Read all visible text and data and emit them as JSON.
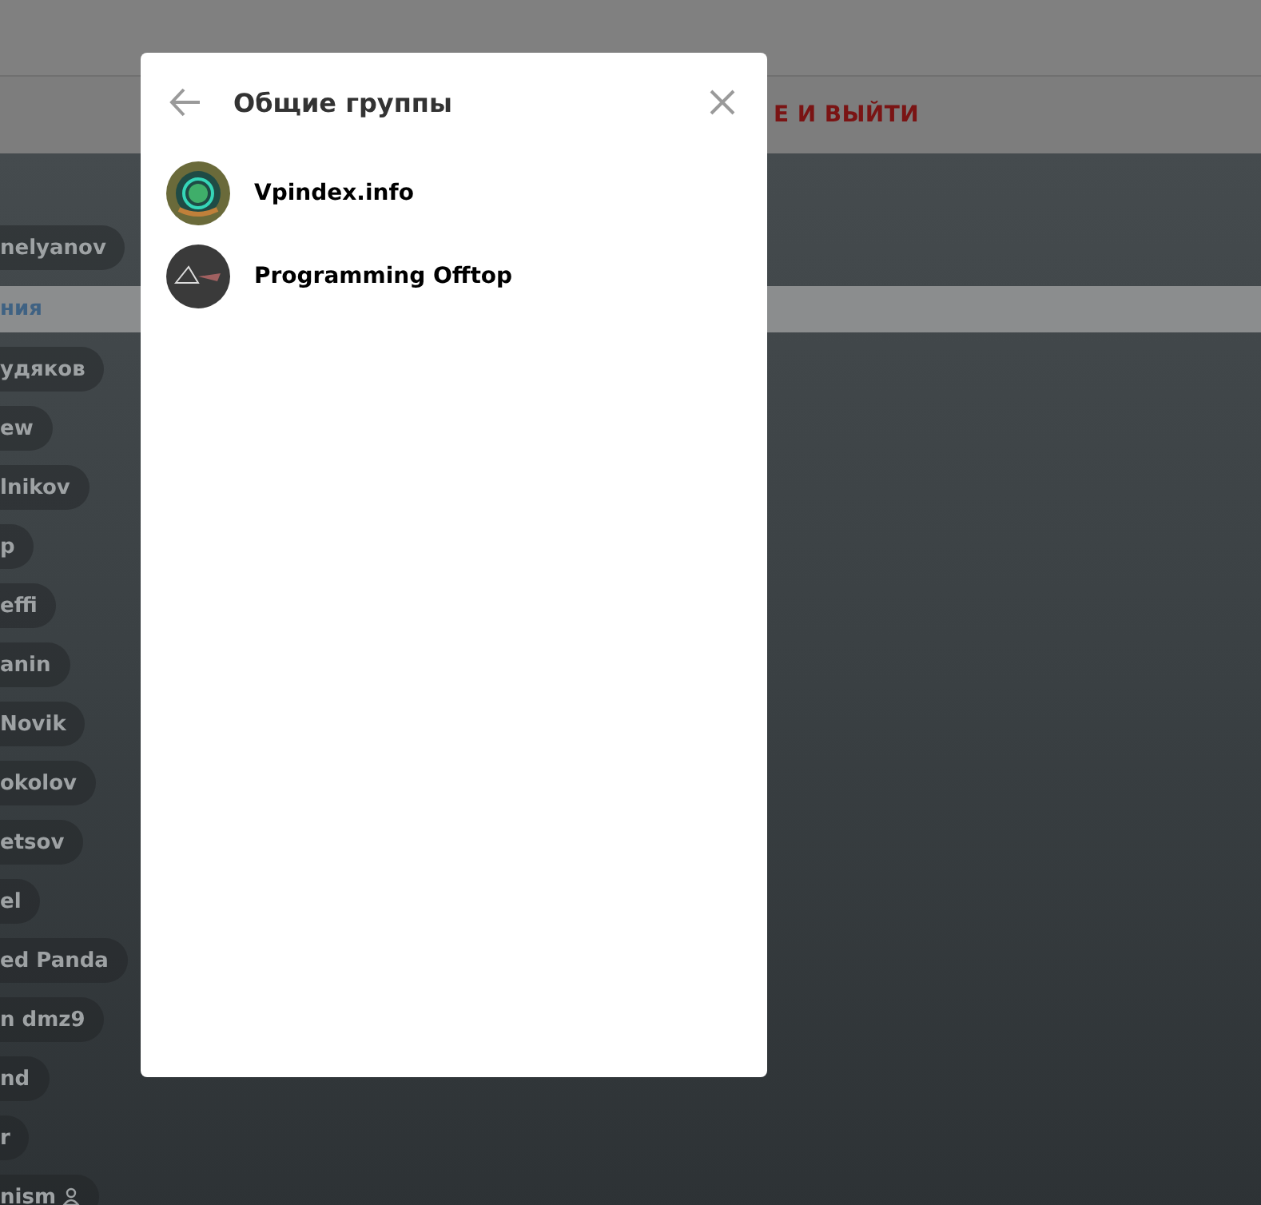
{
  "background": {
    "header_action": "Е И ВЫЙТИ",
    "top_chip": "nelyanov",
    "strip_label": "ния",
    "chips": [
      {
        "label": "удяков",
        "badge": false
      },
      {
        "label": "ew",
        "badge": false
      },
      {
        "label": "lnikov",
        "badge": false
      },
      {
        "label": "p",
        "badge": false
      },
      {
        "label": "effi",
        "badge": false
      },
      {
        "label": "anin",
        "badge": false
      },
      {
        "label": "Novik",
        "badge": false
      },
      {
        "label": "okolov",
        "badge": false
      },
      {
        "label": "etsov",
        "badge": false
      },
      {
        "label": "el",
        "badge": false
      },
      {
        "label": "ed Panda",
        "badge": false
      },
      {
        "label": "n dmz9",
        "badge": false
      },
      {
        "label": "nd",
        "badge": false
      },
      {
        "label": "r",
        "badge": false
      },
      {
        "label": "nism",
        "badge": true
      }
    ]
  },
  "dialog": {
    "title": "Общие группы",
    "groups": [
      {
        "name": "Vpindex.info",
        "kind": "crypto"
      },
      {
        "name": "Programming Offtop",
        "kind": "dark"
      }
    ]
  }
}
